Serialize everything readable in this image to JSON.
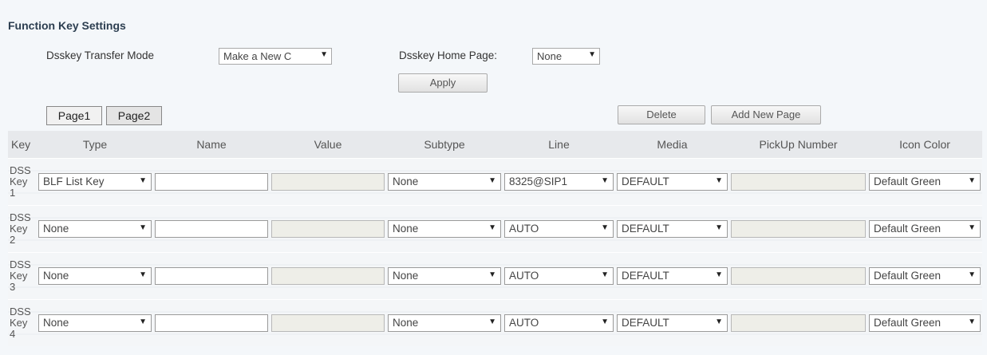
{
  "section": {
    "title": "Function Key Settings"
  },
  "controls": {
    "transfer_mode_label": "Dsskey Transfer Mode",
    "transfer_mode_value": "Make a New C",
    "home_page_label": "Dsskey Home Page:",
    "home_page_value": "None",
    "apply_label": "Apply"
  },
  "pages": {
    "page1": "Page1",
    "page2": "Page2",
    "active": "Page2"
  },
  "actions": {
    "delete_label": "Delete",
    "add_page_label": "Add New Page"
  },
  "table": {
    "headers": [
      "Key",
      "Type",
      "Name",
      "Value",
      "Subtype",
      "Line",
      "Media",
      "PickUp Number",
      "Icon Color"
    ],
    "rows": [
      {
        "key": [
          "DSS",
          "Key",
          "1"
        ],
        "type": "BLF List Key",
        "name": "",
        "value": "",
        "subtype": "None",
        "line": "8325@SIP1",
        "media": "DEFAULT",
        "pickup": "",
        "icon_color": "Default Green"
      },
      {
        "key": [
          "DSS",
          "Key",
          "2"
        ],
        "type": "None",
        "name": "",
        "value": "",
        "subtype": "None",
        "line": "AUTO",
        "media": "DEFAULT",
        "pickup": "",
        "icon_color": "Default Green"
      },
      {
        "key": [
          "DSS",
          "Key",
          "3"
        ],
        "type": "None",
        "name": "",
        "value": "",
        "subtype": "None",
        "line": "AUTO",
        "media": "DEFAULT",
        "pickup": "",
        "icon_color": "Default Green"
      },
      {
        "key": [
          "DSS",
          "Key",
          "4"
        ],
        "type": "None",
        "name": "",
        "value": "",
        "subtype": "None",
        "line": "AUTO",
        "media": "DEFAULT",
        "pickup": "",
        "icon_color": "Default Green"
      }
    ]
  },
  "icons": {
    "dropdown": "▼"
  }
}
